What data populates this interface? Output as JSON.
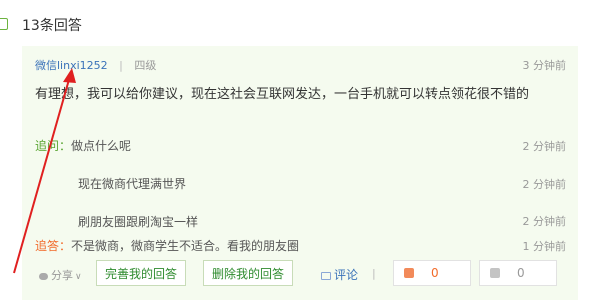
{
  "header": {
    "title": "13条回答"
  },
  "answer": {
    "user": "微信linxi1252",
    "separator": "|",
    "level": "四级",
    "time": "3 分钟前",
    "text": "有理想，我可以给你建议，现在这社会互联网发达，一台手机就可以转点领花很不错的"
  },
  "thread": [
    {
      "label": "追问：",
      "text": "做点什么呢",
      "time": "2 分钟前",
      "kind": "followup"
    },
    {
      "label": "",
      "text": "现在微商代理满世界",
      "time": "2 分钟前",
      "kind": "followup"
    },
    {
      "label": "",
      "text": "刷朋友圈跟刷淘宝一样",
      "time": "2 分钟前",
      "kind": "followup"
    },
    {
      "label": "追答：",
      "text": "不是微商，微商学生不适合。看我的朋友圈",
      "time": "1 分钟前",
      "kind": "reply"
    }
  ],
  "actions": {
    "share": "分享",
    "share_caret": "∨",
    "improve": "完善我的回答",
    "delete": "删除我的回答",
    "comment": "评论",
    "sep": "|",
    "like_count": "0",
    "dislike_count": "0"
  },
  "colors": {
    "accent_green": "#5aa532",
    "accent_orange": "#f26b2a",
    "link_blue": "#3b73b9",
    "panel_bg": "#f5fbef",
    "arrow_red": "#e02020"
  },
  "icons": [
    "comment-bubble-icon",
    "share-icon",
    "comment-icon",
    "thumbs-up-icon",
    "thumbs-down-icon"
  ]
}
